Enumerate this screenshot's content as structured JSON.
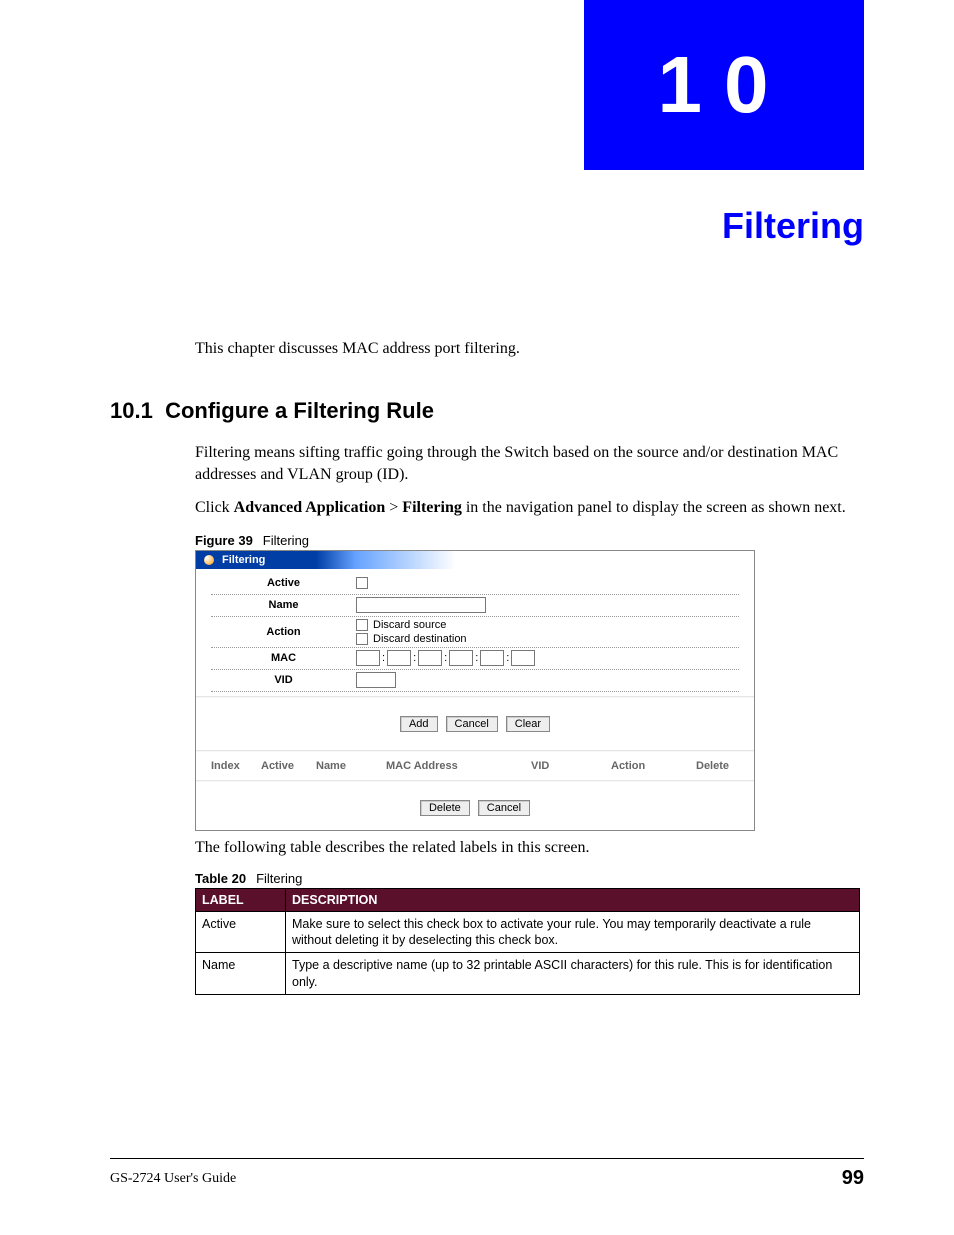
{
  "chapter": {
    "number": "10",
    "title": "Filtering"
  },
  "intro": "This chapter discusses MAC address port filtering.",
  "section": {
    "number": "10.1",
    "title": "Configure a Filtering Rule",
    "p1": "Filtering means sifting traffic going through the Switch based on the source and/or destination MAC addresses and VLAN group (ID).",
    "p2_pre": "Click ",
    "p2_b1": "Advanced Application",
    "p2_mid": " > ",
    "p2_b2": "Filtering",
    "p2_post": " in the navigation panel to display the screen as shown next."
  },
  "figure": {
    "label": "Figure 39",
    "caption": "Filtering",
    "panel_title": "Filtering",
    "rows": {
      "active": "Active",
      "name": "Name",
      "action": "Action",
      "action_opt1": "Discard source",
      "action_opt2": "Discard destination",
      "mac": "MAC",
      "vid": "VID"
    },
    "buttons": {
      "add": "Add",
      "cancel": "Cancel",
      "clear": "Clear",
      "delete": "Delete",
      "cancel2": "Cancel"
    },
    "list_headers": {
      "index": "Index",
      "active": "Active",
      "name": "Name",
      "mac": "MAC Address",
      "vid": "VID",
      "action": "Action",
      "delete": "Delete"
    }
  },
  "after_figure": "The following table describes the related labels in this screen.",
  "table": {
    "label": "Table 20",
    "caption": "Filtering",
    "headers": {
      "label": "LABEL",
      "description": "DESCRIPTION"
    },
    "rows": [
      {
        "label": "Active",
        "desc": "Make sure to select this check box to activate your rule. You may temporarily deactivate a rule without deleting it by deselecting this check box."
      },
      {
        "label": "Name",
        "desc": "Type a descriptive name (up to 32 printable ASCII characters) for this rule. This is for identification only."
      }
    ]
  },
  "footer": {
    "guide": "GS-2724 User's Guide",
    "page": "99"
  }
}
